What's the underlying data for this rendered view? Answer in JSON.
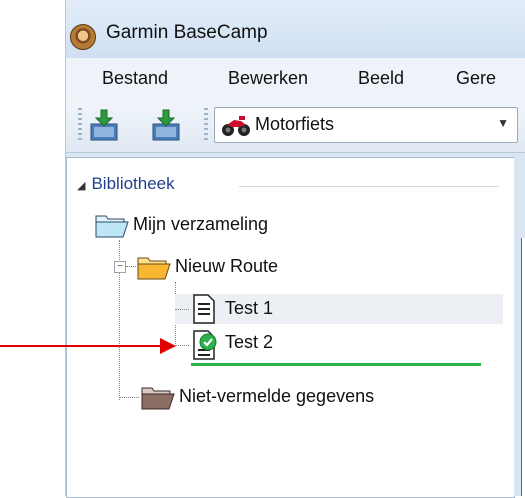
{
  "window": {
    "title": "Garmin BaseCamp"
  },
  "menu": {
    "items": [
      "Bestand",
      "Bewerken",
      "Beeld",
      "Gere"
    ]
  },
  "toolbar": {
    "profile": "Motorfiets"
  },
  "tree": {
    "section": "Bibliotheek",
    "collection": "Mijn verzameling",
    "folder": "Nieuw Route",
    "routes": [
      "Test 1",
      "Test 2"
    ],
    "unlisted": "Niet-vermelde gegevens"
  },
  "colors": {
    "accent_link": "#1f3f8f",
    "annotation_arrow": "#e00000",
    "route_underline": "#2bb24c",
    "active_check": "#2bb24c"
  },
  "icons": {
    "app": "basecamp-icon",
    "import": "import-device-icon",
    "profile": "motorcycle-icon",
    "folder_open": "folder-open-icon",
    "route": "route-document-icon",
    "route_active": "route-active-check-icon"
  }
}
